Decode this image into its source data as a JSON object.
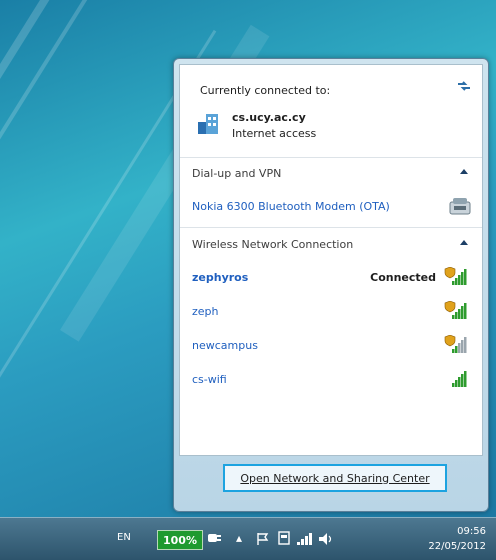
{
  "status": {
    "currently_connected_label": "Currently connected to:",
    "network_name": "cs.ucy.ac.cy",
    "network_access": "Internet access"
  },
  "dialup": {
    "header": "Dial-up and VPN",
    "items": [
      {
        "label": "Nokia 6300 Bluetooth Modem (OTA)",
        "icon": "modem-icon"
      }
    ]
  },
  "wireless": {
    "header": "Wireless Network Connection",
    "networks": [
      {
        "name": "zephyros",
        "status": "Connected",
        "secured": true,
        "signal_bars": 5
      },
      {
        "name": "zeph",
        "status": "",
        "secured": true,
        "signal_bars": 5
      },
      {
        "name": "newcampus",
        "status": "",
        "secured": true,
        "signal_bars": 2
      },
      {
        "name": "cs-wifi",
        "status": "",
        "secured": false,
        "signal_bars": 5
      }
    ]
  },
  "footer": {
    "link_label": "Open Network and Sharing Center"
  },
  "taskbar": {
    "language": "EN",
    "battery_percent": "100%",
    "clock_time": "09:56",
    "clock_date": "22/05/2012"
  },
  "colors": {
    "link": "#1f5fbf",
    "signal_on": "#2e9b2e",
    "signal_off": "#9aa5ad",
    "battery": "#1f9a2f"
  }
}
